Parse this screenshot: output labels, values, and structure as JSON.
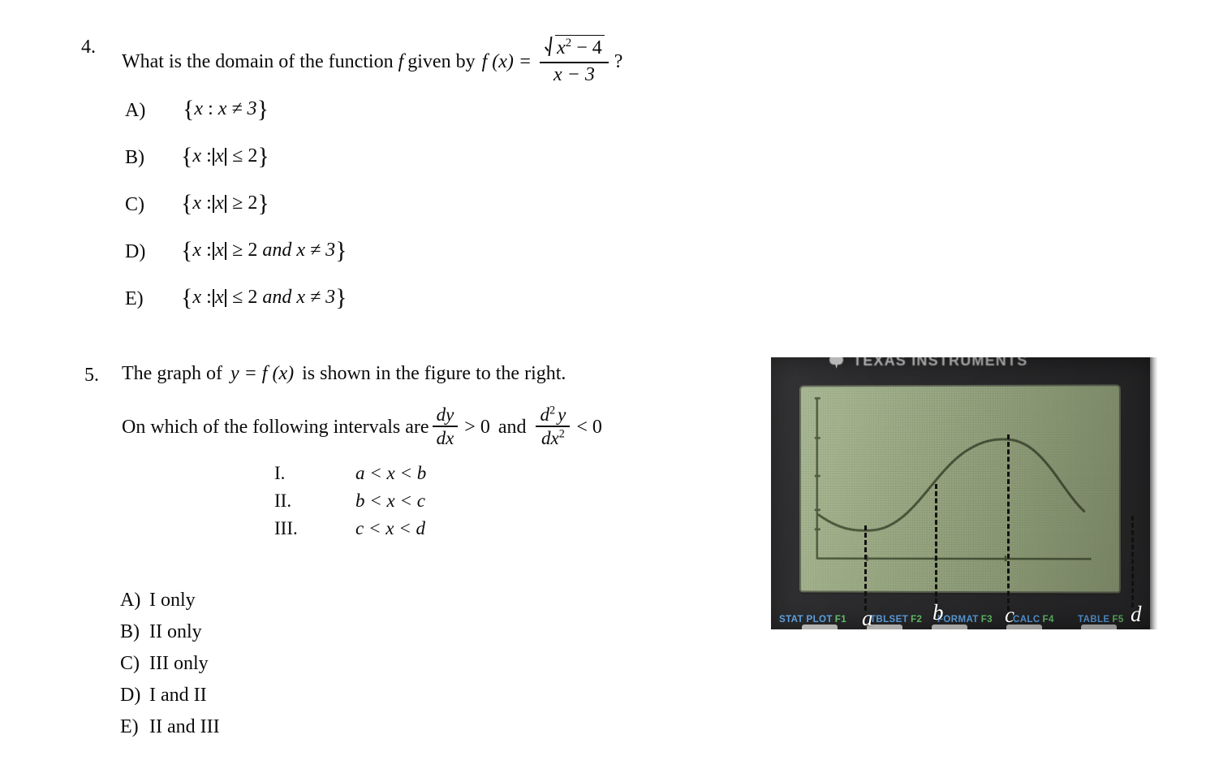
{
  "page": {
    "background": "#ffffff",
    "text_color": "#0b0b0b"
  },
  "question4": {
    "number": "4.",
    "stem_before": "What is the domain of the function",
    "stem_f": "f",
    "stem_middle": "given by",
    "stem_fx": "f (x) =",
    "fraction_numerator_radicand": "x",
    "fraction_numerator_exponent": "2",
    "fraction_numerator_tail": "− 4",
    "fraction_denominator": "x − 3",
    "stem_after": "?",
    "choices": [
      {
        "letter": "A)",
        "open": "{",
        "var": "x",
        "colon": ":",
        "body": "x ≠ 3",
        "close": "}",
        "has_abs": false,
        "abs_var": "",
        "rel": "",
        "extra": ""
      },
      {
        "letter": "B)",
        "open": "{",
        "var": "x",
        "colon": ":",
        "body": "",
        "close": "}",
        "has_abs": true,
        "abs_var": "x",
        "rel": "≤ 2",
        "extra": ""
      },
      {
        "letter": "C)",
        "open": "{",
        "var": "x",
        "colon": ":",
        "body": "",
        "close": "}",
        "has_abs": true,
        "abs_var": "x",
        "rel": "≥ 2",
        "extra": ""
      },
      {
        "letter": "D)",
        "open": "{",
        "var": "x",
        "colon": ":",
        "body": "",
        "close": "}",
        "has_abs": true,
        "abs_var": "x",
        "rel": "≥ 2",
        "extra": "and x ≠ 3"
      },
      {
        "letter": "E)",
        "open": "{",
        "var": "x",
        "colon": ":",
        "body": "",
        "close": "}",
        "has_abs": true,
        "abs_var": "x",
        "rel": "≤ 2",
        "extra": "and x ≠ 3"
      }
    ],
    "choice_texts": [
      "A)  {x : x ≠ 3}",
      "B)  {x : |x| ≤ 2}",
      "C)  {x : |x| ≥ 2}",
      "D)  {x : |x| ≥ 2 and x ≠ 3}",
      "E)  {x : |x| ≤ 2 and x ≠ 3}"
    ]
  },
  "question5": {
    "number": "5.",
    "line1_a": "The graph of",
    "line1_eq": "y = f (x)",
    "line1_b": "is shown in the figure to the right.",
    "line2_a": "On which of the following intervals are",
    "first_derivative_numerator": "dy",
    "first_derivative_denominator": "dx",
    "first_derivative_relation": "> 0",
    "conjunction": "and",
    "second_derivative_numerator_d": "d",
    "second_derivative_numerator_exp": "2",
    "second_derivative_numerator_y": "y",
    "second_derivative_denominator_dx": "dx",
    "second_derivative_denominator_exp": "2",
    "second_derivative_relation": "< 0",
    "romans": [
      {
        "numeral": "I.",
        "interval": "a < x < b"
      },
      {
        "numeral": "II.",
        "interval": "b < x < c"
      },
      {
        "numeral": "III.",
        "interval": "c < x < d"
      }
    ],
    "choices": [
      {
        "letter": "A)",
        "text": "I only"
      },
      {
        "letter": "B)",
        "text": "II only"
      },
      {
        "letter": "C)",
        "text": "III only"
      },
      {
        "letter": "D)",
        "text": "I and II"
      },
      {
        "letter": "E)",
        "text": "II and III"
      }
    ]
  },
  "calculator": {
    "brand": "TEXAS INSTRUMENTS",
    "bezel_color": "#2b2b2d",
    "screen_color": "#9fae88",
    "trace_color": "#4a573a",
    "function_keys": [
      {
        "name": "STAT PLOT",
        "id": "F1"
      },
      {
        "name": "TBLSET",
        "id": "F2"
      },
      {
        "name": "FORMAT",
        "id": "F3"
      },
      {
        "name": "CALC",
        "id": "F4"
      },
      {
        "name": "TABLE",
        "id": "F5"
      }
    ],
    "markers": [
      {
        "label": "a"
      },
      {
        "label": "b"
      },
      {
        "label": "c"
      },
      {
        "label": "d"
      }
    ]
  },
  "chart_data": {
    "type": "line",
    "title": "",
    "xlabel": "",
    "ylabel": "",
    "description": "Calculator graph of y = f(x): decreasing to a local minimum near x = a, then increasing with an inflection point near x = b, reaching a local maximum just before x = c, then decreasing toward x = d.",
    "xlim": [
      0,
      100
    ],
    "ylim": [
      0,
      100
    ],
    "grid": true,
    "legend": "none",
    "x": [
      0,
      4,
      8,
      12,
      16,
      20,
      24,
      28,
      32,
      36,
      40,
      44,
      48,
      52,
      56,
      60,
      64,
      68,
      72,
      76,
      80,
      84,
      88
    ],
    "y": [
      36,
      30,
      26,
      24,
      24,
      25,
      28,
      33,
      40,
      48,
      56,
      63,
      69,
      73,
      76,
      77,
      77,
      75,
      72,
      67,
      61,
      54,
      47
    ],
    "markers": [
      {
        "label": "a",
        "x": 14,
        "note": "local minimum"
      },
      {
        "label": "b",
        "x": 40,
        "note": "inflection point, curve rising"
      },
      {
        "label": "c",
        "x": 66,
        "note": "just past local maximum"
      },
      {
        "label": "d",
        "x": 104,
        "note": "right of the visible screen"
      }
    ]
  }
}
